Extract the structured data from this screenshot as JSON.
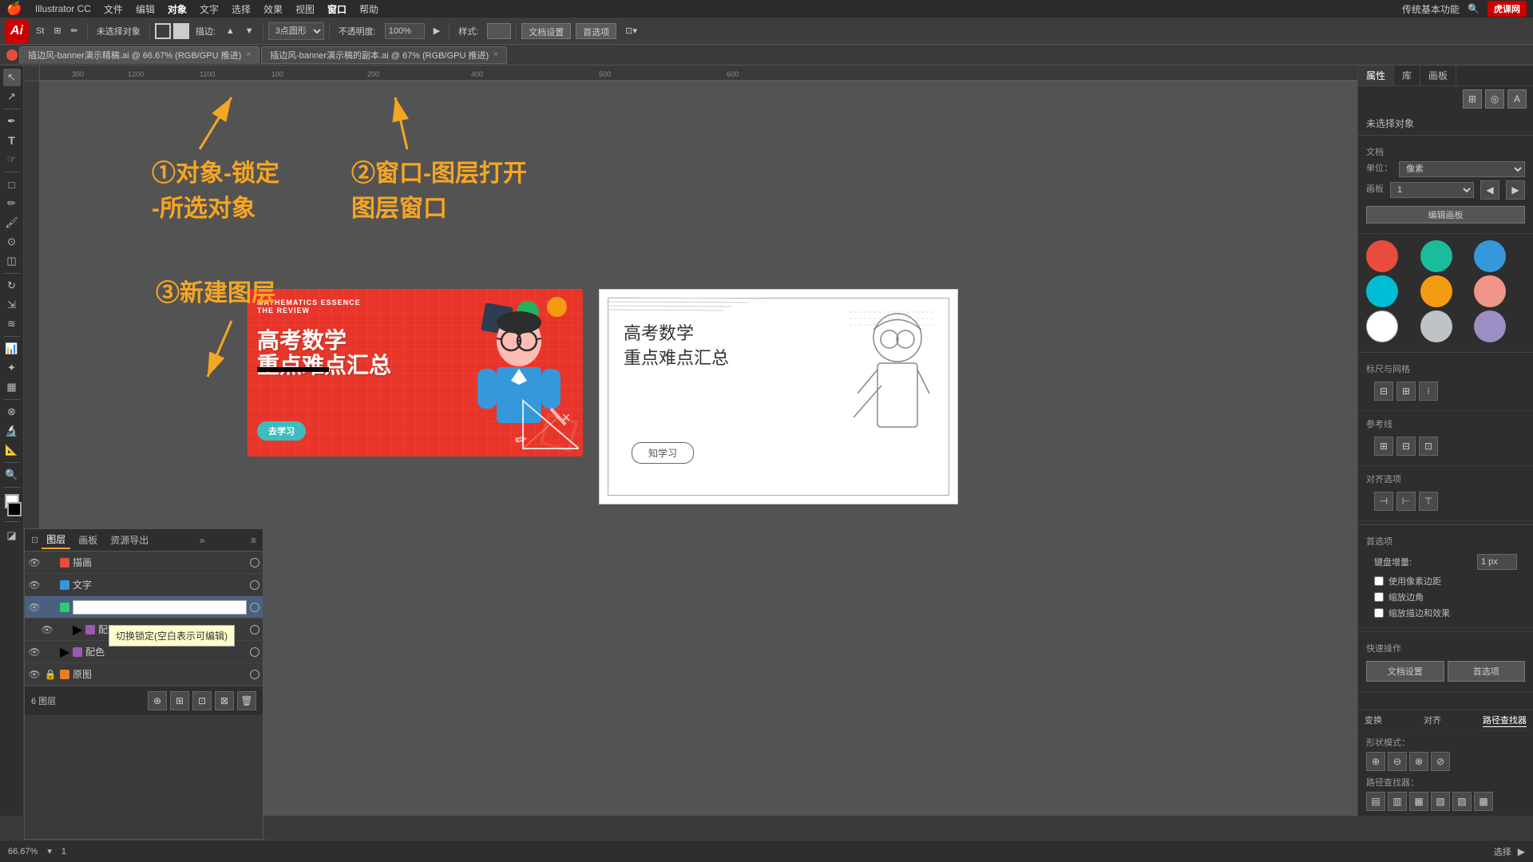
{
  "app": {
    "name": "Illustrator CC",
    "logo": "Ai",
    "zoom": "66.67%",
    "page": "1"
  },
  "menu": {
    "apple": "🍎",
    "items": [
      "Illustrator CC",
      "文件",
      "编辑",
      "对象",
      "文字",
      "选择",
      "效果",
      "视图",
      "窗口",
      "帮助"
    ]
  },
  "toolbar": {
    "no_selection": "未选择对象",
    "stroke_label": "描边:",
    "shape_label": "3点圆形",
    "opacity_label": "不透明度:",
    "opacity_value": "100%",
    "style_label": "样式:",
    "doc_settings": "文档设置",
    "preferences": "首选项"
  },
  "tabs": [
    {
      "label": "插边风-banner演示精稿.ai @ 66.67% (RGB/GPU 推进)",
      "active": true
    },
    {
      "label": "插边风-banner演示稿的副本.ai @ 67% (RGB/GPU 推进)",
      "active": false
    }
  ],
  "annotations": {
    "step1": "①对象-锁定",
    "step1b": "-所选对象",
    "step2": "②窗口-图层打开",
    "step2b": "图层窗口",
    "step3": "③新建图层"
  },
  "canvas": {
    "background": "#535353"
  },
  "layers_panel": {
    "title": "图层",
    "tabs": [
      "图层",
      "画板",
      "资源导出"
    ],
    "layers": [
      {
        "name": "描画",
        "color": "#e74c3c",
        "visible": true,
        "locked": false,
        "active": false
      },
      {
        "name": "文字",
        "color": "#3498db",
        "visible": true,
        "locked": false,
        "active": false
      },
      {
        "name": "",
        "color": "#2ecc71",
        "visible": true,
        "locked": false,
        "active": true,
        "editing": true
      },
      {
        "name": "配色",
        "color": "#9b59b6",
        "visible": true,
        "locked": false,
        "active": false,
        "expanded": true
      },
      {
        "name": "配色",
        "color": "#9b59b6",
        "visible": true,
        "locked": false,
        "active": false
      },
      {
        "name": "原图",
        "color": "#e67e22",
        "visible": true,
        "locked": true,
        "active": false
      }
    ],
    "count": "6 图层",
    "tooltip": "切换锁定(空白表示可编辑)"
  },
  "right_panel": {
    "tabs": [
      "属性",
      "库",
      "画板"
    ],
    "active_tab": "属性",
    "title": "未选择对象",
    "doc_section": "文档",
    "unit_label": "单位：",
    "unit_value": "像素",
    "artboard_label": "画板",
    "artboard_value": "1",
    "edit_btn": "编辑画板",
    "rulers_label": "标尺与网格",
    "guides_label": "参考线",
    "align_label": "对齐选项",
    "preferences_label": "首选项",
    "keyboard_increment_label": "键盘增量:",
    "keyboard_increment_value": "1 px",
    "snap_pixel_label": "使用像素边距",
    "corner_label": "缩放边角",
    "scale_stroke_label": "缩放描边和效果",
    "quick_actions_label": "快速操作",
    "doc_settings_btn": "文档设置",
    "preferences_btn": "首选项"
  },
  "colors": {
    "red": "#e74c3c",
    "teal": "#1abc9c",
    "blue": "#3498db",
    "cyan": "#00bcd4",
    "orange": "#f39c12",
    "pink": "#f1948a",
    "white": "#ffffff",
    "lightgray": "#bdc3c7",
    "purple": "#9b8ec4"
  },
  "banner": {
    "title_en_1": "MATHEMATICS ESSENCE",
    "title_en_2": "THE REVIEW",
    "title_cn_1": "高考数学",
    "title_cn_2": "重点难点汇总",
    "btn_label": "去学习"
  },
  "status_bar": {
    "zoom": "66.67%",
    "page_label": "选择",
    "artboard": "1"
  },
  "top_bar": {
    "features": "传统基本功能",
    "logo_text": "虎课网"
  },
  "path_finder": {
    "title": "路径查找器",
    "shape_modes_label": "形状模式：",
    "pathfinder_label": "路径查找器："
  }
}
